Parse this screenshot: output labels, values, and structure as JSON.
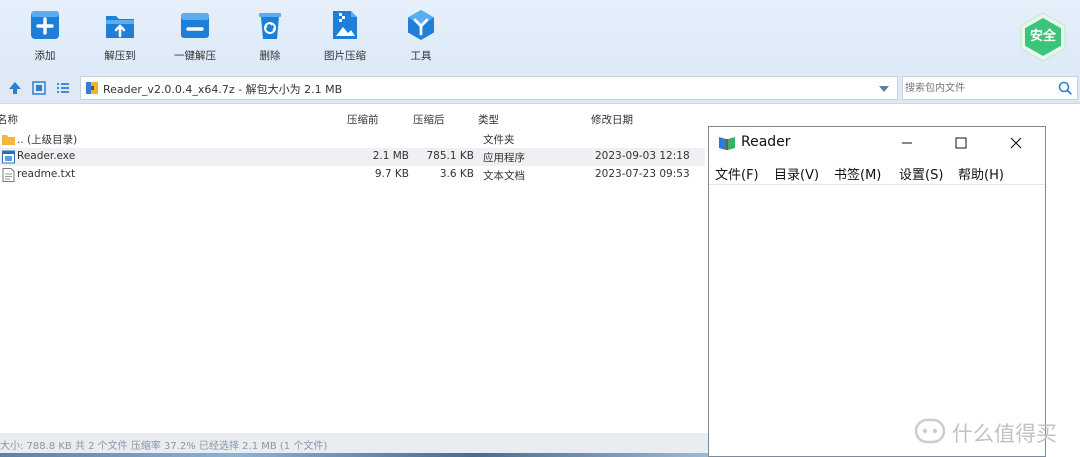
{
  "toolbar": {
    "items": [
      {
        "label": "添加",
        "icon": "add-icon"
      },
      {
        "label": "解压到",
        "icon": "extract-to-icon"
      },
      {
        "label": "一键解压",
        "icon": "one-click-extract-icon"
      },
      {
        "label": "删除",
        "icon": "delete-icon"
      },
      {
        "label": "图片压缩",
        "icon": "image-compress-icon"
      },
      {
        "label": "工具",
        "icon": "tools-icon"
      }
    ],
    "badge_label": "安全"
  },
  "address": {
    "path": "Reader_v2.0.0.4_x64.7z - 解包大小为 2.1 MB",
    "search_placeholder": "搜索包内文件"
  },
  "columns": {
    "name": "名称",
    "before": "压缩前",
    "after": "压缩后",
    "type": "类型",
    "modified": "修改日期"
  },
  "files": [
    {
      "name": ".. (上级目录)",
      "before": "",
      "after": "",
      "type": "文件夹",
      "modified": ""
    },
    {
      "name": "Reader.exe",
      "before": "2.1 MB",
      "after": "785.1 KB",
      "type": "应用程序",
      "modified": "2023-09-03 12:18"
    },
    {
      "name": "readme.txt",
      "before": "9.7 KB",
      "after": "3.6 KB",
      "type": "文本文档",
      "modified": "2023-07-23 09:53"
    }
  ],
  "status": {
    "text": "大小: 788.8 KB 共 2 个文件 压缩率 37.2% 已经选择 2.1 MB (1 个文件)"
  },
  "reader": {
    "title": "Reader",
    "menu": [
      "文件(F)",
      "目录(V)",
      "书签(M)",
      "设置(S)",
      "帮助(H)"
    ]
  },
  "watermark": {
    "text": "什么值得买"
  },
  "colors": {
    "accent": "#1e7fd8",
    "badge": "#3cc47a"
  }
}
